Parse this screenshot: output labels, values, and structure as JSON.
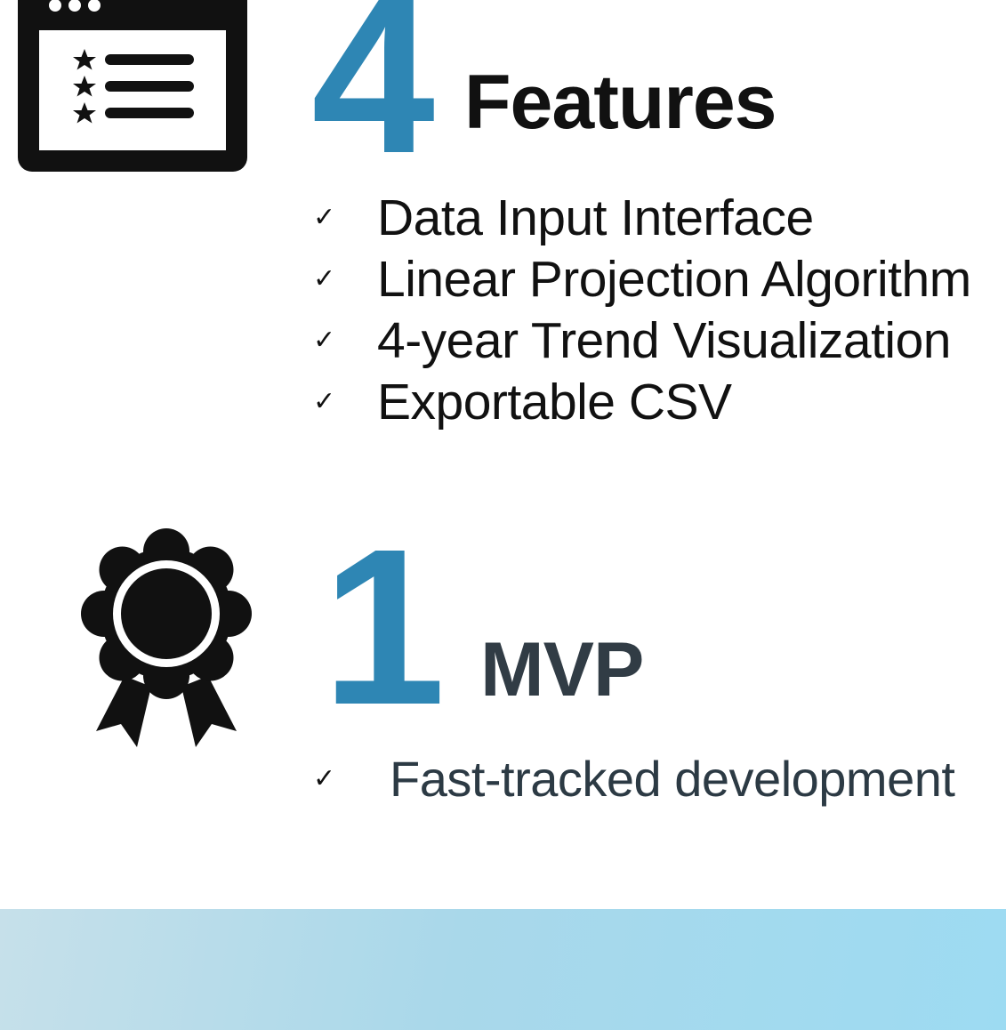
{
  "features": {
    "count": "4",
    "title": "Features",
    "icon": "browser-rating-icon",
    "items": [
      {
        "check": "✓",
        "label": "Data Input Interface"
      },
      {
        "check": "✓",
        "label": "Linear Projection Algorithm"
      },
      {
        "check": "✓",
        "label": "4-year Trend Visualization"
      },
      {
        "check": "✓",
        "label": "Exportable CSV"
      }
    ]
  },
  "mvp": {
    "count": "1",
    "title": "MVP",
    "icon": "award-ribbon-icon",
    "items": [
      {
        "check": "✓",
        "label": "Fast-tracked development"
      }
    ]
  },
  "colors": {
    "accent": "#2e86b4",
    "text": "#111111",
    "muted_text": "#2c3a44",
    "band_start": "#c6e0ea",
    "band_end": "#9ddbf2"
  }
}
